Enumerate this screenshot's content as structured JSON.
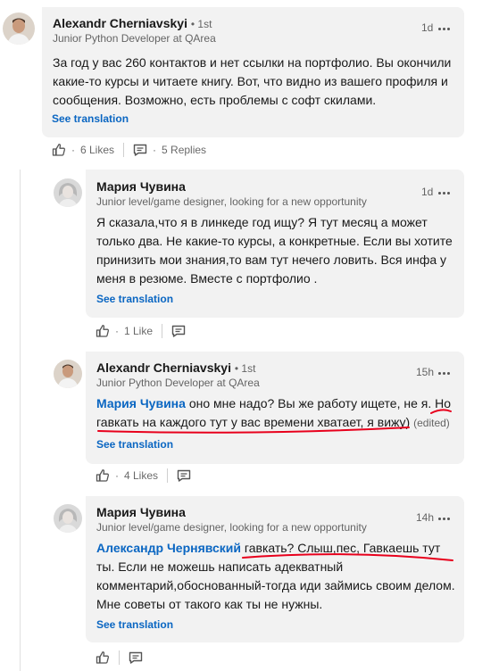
{
  "comments": [
    {
      "author": "Alexandr Cherniavskyi",
      "degree": "1st",
      "headline": "Junior Python Developer at QArea",
      "time": "1d",
      "text": "За год у вас 260 контактов и нет ссылки на портфолио. Вы окончили какие-то курсы и читаете книгу. Вот, что видно из вашего профиля и сообщения. Возможно, есть проблемы с софт скилами.",
      "see_translation": "See translation",
      "likes": "6 Likes",
      "replies": "5 Replies"
    }
  ],
  "replies": [
    {
      "author": "Мария Чувина",
      "headline": "Junior level/game designer, looking for a new opportunity",
      "time": "1d",
      "text": "Я сказала,что я в линкеде год ищу? Я тут месяц а может только два. Не какие-то курсы, а конкретные. Если вы хотите принизить мои знания,то вам тут нечего ловить. Вся инфа у меня в резюме. Вместе с портфолио .",
      "see_translation": "See translation",
      "likes": "1 Like"
    },
    {
      "author": "Alexandr Cherniavskyi",
      "degree": "1st",
      "headline": "Junior Python Developer at QArea",
      "time": "15h",
      "mention": "Мария Чувина",
      "text": "оно мне надо? Вы же работу ищете, не я. Но гавкать на каждого тут у вас времени хватает, я вижу)",
      "edited": "(edited)",
      "see_translation": "See translation",
      "likes": "4 Likes"
    },
    {
      "author": "Мария Чувина",
      "headline": "Junior level/game designer, looking for a new opportunity",
      "time": "14h",
      "mention": "Александр Чернявский",
      "text": "гавкать? Слыш,пес, Гавкаешь тут ты. Если не можешь написать адекватный комментарий,обоснованный-тогда иди займись своим делом. Мне советы от такого как ты не нужны.",
      "see_translation": "See translation"
    }
  ],
  "colors": {
    "link": "#0a66c2",
    "bubble": "#f2f2f2",
    "annotation": "#e8001c"
  }
}
